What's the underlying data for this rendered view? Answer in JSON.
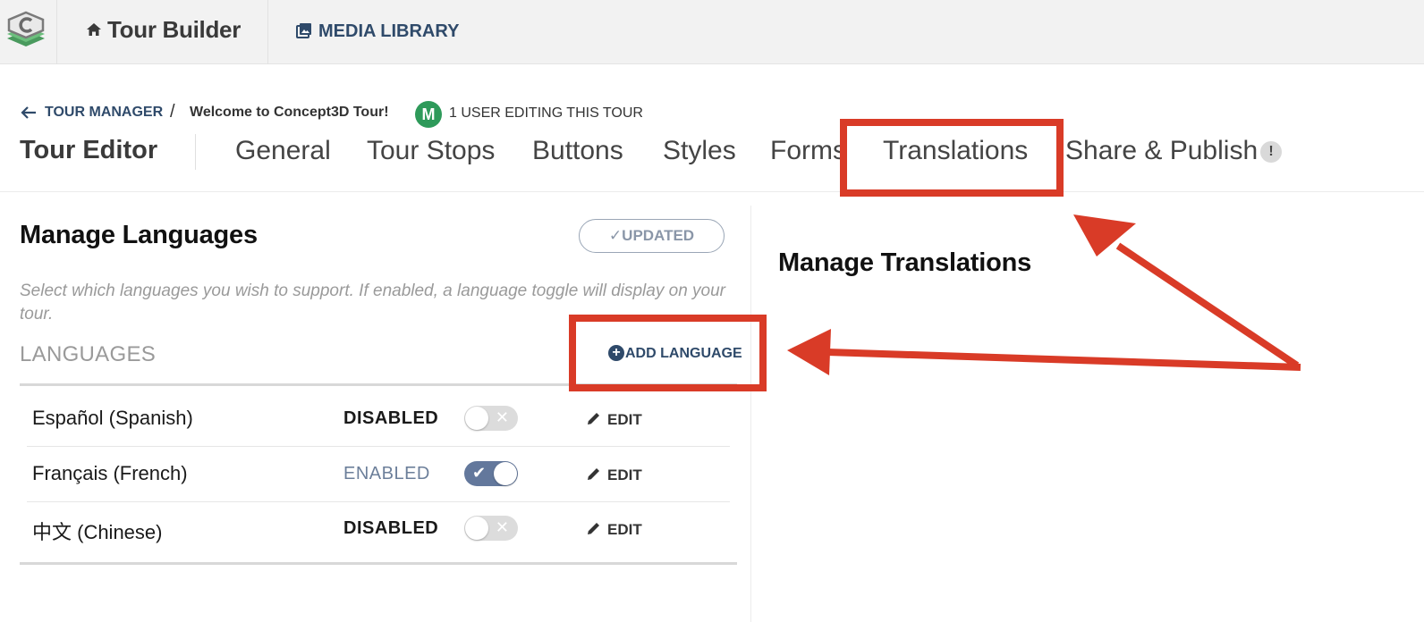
{
  "topbar": {
    "logo_icon": "concept3d-logo-icon",
    "home_label": "Tour Builder",
    "media_label": "MEDIA LIBRARY"
  },
  "breadcrumb": {
    "manager_label": "TOUR MANAGER",
    "separator": "/",
    "tour_title": "Welcome to Concept3D Tour!",
    "avatar_initial": "M",
    "editing_text": "1 USER EDITING THIS TOUR"
  },
  "editor": {
    "title": "Tour Editor",
    "tabs": [
      {
        "label": "General"
      },
      {
        "label": "Tour Stops"
      },
      {
        "label": "Buttons"
      },
      {
        "label": "Styles"
      },
      {
        "label": "Forms"
      },
      {
        "label": "Translations"
      },
      {
        "label": "Share & Publish"
      }
    ],
    "warning_glyph": "!"
  },
  "manage_languages": {
    "title": "Manage Languages",
    "updated_label": "✓UPDATED",
    "help_text": "Select which languages you wish to support. If enabled, a language toggle will display on your tour.",
    "languages_label": "LANGUAGES",
    "add_glyph": "+",
    "add_label": "ADD LANGUAGE",
    "rows": [
      {
        "name": "Español (Spanish)",
        "status": "DISABLED",
        "enabled": false,
        "toggle_mark": "✕",
        "edit_label": "EDIT"
      },
      {
        "name": "Français (French)",
        "status": "ENABLED",
        "enabled": true,
        "toggle_mark": "✔",
        "edit_label": "EDIT"
      },
      {
        "name": "中文 (Chinese)",
        "status": "DISABLED",
        "enabled": false,
        "toggle_mark": "✕",
        "edit_label": "EDIT"
      }
    ]
  },
  "manage_translations": {
    "title": "Manage Translations"
  },
  "colors": {
    "accent_navy": "#2f4a6a",
    "toggle_on": "#63789c",
    "annotation_red": "#d93b27",
    "avatar_green": "#2e9a5a"
  }
}
